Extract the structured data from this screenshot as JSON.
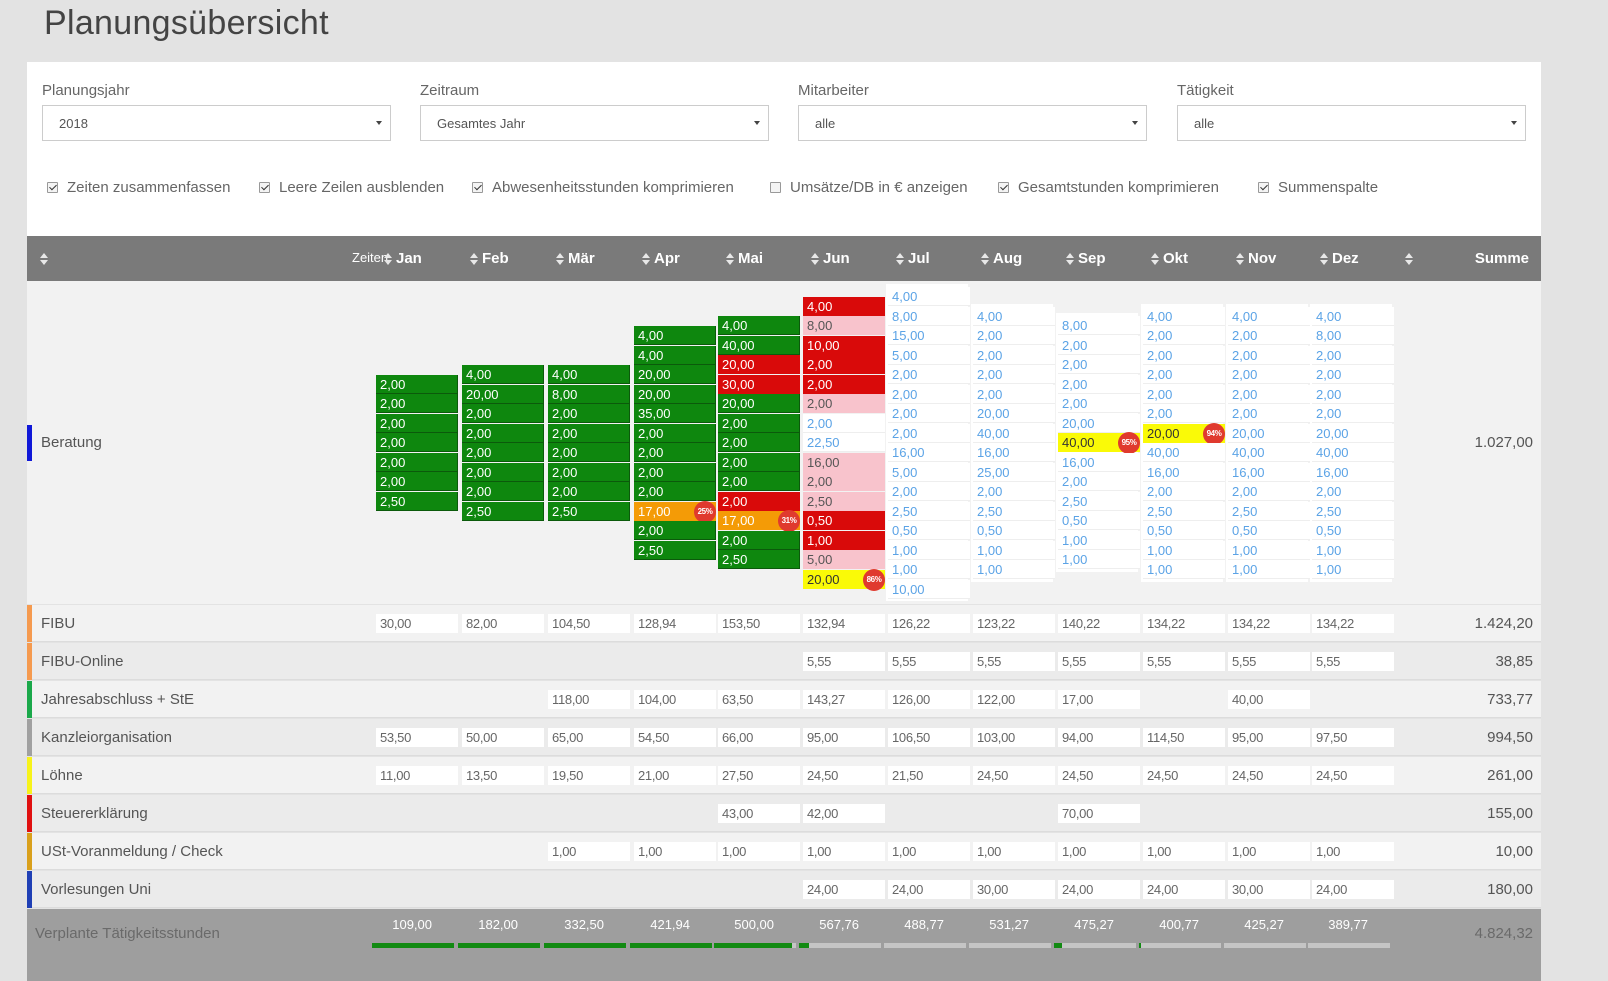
{
  "page": {
    "title": "Planungsübersicht"
  },
  "filters": [
    {
      "label": "Planungsjahr",
      "value": "2018"
    },
    {
      "label": "Zeitraum",
      "value": "Gesamtes Jahr"
    },
    {
      "label": "Mitarbeiter",
      "value": "alle"
    },
    {
      "label": "Tätigkeit",
      "value": "alle"
    }
  ],
  "options": [
    {
      "label": "Zeiten zusammenfassen",
      "checked": true
    },
    {
      "label": "Leere Zeilen ausblenden",
      "checked": true
    },
    {
      "label": "Abwesenheitsstunden komprimieren",
      "checked": true
    },
    {
      "label": "Umsätze/DB in € anzeigen",
      "checked": false
    },
    {
      "label": "Gesamtstunden komprimieren",
      "checked": true
    },
    {
      "label": "Summenspalte",
      "checked": true
    }
  ],
  "table": {
    "zeiten_label": "Zeiten",
    "months": [
      "Jan",
      "Feb",
      "Mär",
      "Apr",
      "Mai",
      "Jun",
      "Jul",
      "Aug",
      "Sep",
      "Okt",
      "Nov",
      "Dez"
    ],
    "sum_label": "Summe",
    "colors": {
      "g": "#0e870e",
      "r": "#d90a0a",
      "p": "#f8c3cc",
      "o": "#f49b06",
      "y": "#fafa07",
      "b": "#5ba3e6"
    },
    "beratung": {
      "label": "Beratung",
      "color": "#1018d8",
      "sum": "1.027,00",
      "months": [
        [
          [
            "2,00",
            "g"
          ],
          [
            "2,00",
            "g"
          ],
          [
            "2,00",
            "g"
          ],
          [
            "2,00",
            "g"
          ],
          [
            "2,00",
            "g"
          ],
          [
            "2,00",
            "g"
          ],
          [
            "2,50",
            "g"
          ]
        ],
        [
          [
            "4,00",
            "g"
          ],
          [
            "20,00",
            "g"
          ],
          [
            "2,00",
            "g"
          ],
          [
            "2,00",
            "g"
          ],
          [
            "2,00",
            "g"
          ],
          [
            "2,00",
            "g"
          ],
          [
            "2,00",
            "g"
          ],
          [
            "2,50",
            "g"
          ]
        ],
        [
          [
            "4,00",
            "g"
          ],
          [
            "8,00",
            "g"
          ],
          [
            "2,00",
            "g"
          ],
          [
            "2,00",
            "g"
          ],
          [
            "2,00",
            "g"
          ],
          [
            "2,00",
            "g"
          ],
          [
            "2,00",
            "g"
          ],
          [
            "2,50",
            "g"
          ]
        ],
        [
          [
            "4,00",
            "g"
          ],
          [
            "4,00",
            "g"
          ],
          [
            "20,00",
            "g"
          ],
          [
            "20,00",
            "g"
          ],
          [
            "35,00",
            "g"
          ],
          [
            "2,00",
            "g"
          ],
          [
            "2,00",
            "g"
          ],
          [
            "2,00",
            "g"
          ],
          [
            "2,00",
            "g"
          ],
          [
            "17,00",
            "o",
            "25%"
          ],
          [
            "2,00",
            "g"
          ],
          [
            "2,50",
            "g"
          ]
        ],
        [
          [
            "4,00",
            "g"
          ],
          [
            "40,00",
            "g"
          ],
          [
            "20,00",
            "r"
          ],
          [
            "30,00",
            "r"
          ],
          [
            "20,00",
            "g"
          ],
          [
            "2,00",
            "g"
          ],
          [
            "2,00",
            "g"
          ],
          [
            "2,00",
            "g"
          ],
          [
            "2,00",
            "g"
          ],
          [
            "2,00",
            "r"
          ],
          [
            "17,00",
            "o",
            "31%"
          ],
          [
            "2,00",
            "g"
          ],
          [
            "2,50",
            "g"
          ]
        ],
        [
          [
            "4,00",
            "r"
          ],
          [
            "8,00",
            "p"
          ],
          [
            "10,00",
            "r"
          ],
          [
            "2,00",
            "r"
          ],
          [
            "2,00",
            "r"
          ],
          [
            "2,00",
            "p"
          ],
          [
            "2,00",
            "b"
          ],
          [
            "22,50",
            "b"
          ],
          [
            "16,00",
            "p"
          ],
          [
            "2,00",
            "p"
          ],
          [
            "2,50",
            "p"
          ],
          [
            "0,50",
            "r"
          ],
          [
            "1,00",
            "r"
          ],
          [
            "5,00",
            "p"
          ],
          [
            "20,00",
            "y",
            "86%"
          ]
        ],
        [
          [
            "4,00",
            "b"
          ],
          [
            "8,00",
            "b"
          ],
          [
            "15,00",
            "b"
          ],
          [
            "5,00",
            "b"
          ],
          [
            "2,00",
            "b"
          ],
          [
            "2,00",
            "b"
          ],
          [
            "2,00",
            "b"
          ],
          [
            "2,00",
            "b"
          ],
          [
            "16,00",
            "b"
          ],
          [
            "5,00",
            "b"
          ],
          [
            "2,00",
            "b"
          ],
          [
            "2,50",
            "b"
          ],
          [
            "0,50",
            "b"
          ],
          [
            "1,00",
            "b"
          ],
          [
            "1,00",
            "b"
          ],
          [
            "10,00",
            "b"
          ]
        ],
        [
          [
            "4,00",
            "b"
          ],
          [
            "2,00",
            "b"
          ],
          [
            "2,00",
            "b"
          ],
          [
            "2,00",
            "b"
          ],
          [
            "2,00",
            "b"
          ],
          [
            "20,00",
            "b"
          ],
          [
            "40,00",
            "b"
          ],
          [
            "16,00",
            "b"
          ],
          [
            "25,00",
            "b"
          ],
          [
            "2,00",
            "b"
          ],
          [
            "2,50",
            "b"
          ],
          [
            "0,50",
            "b"
          ],
          [
            "1,00",
            "b"
          ],
          [
            "1,00",
            "b"
          ]
        ],
        [
          [
            "8,00",
            "b"
          ],
          [
            "2,00",
            "b"
          ],
          [
            "2,00",
            "b"
          ],
          [
            "2,00",
            "b"
          ],
          [
            "2,00",
            "b"
          ],
          [
            "20,00",
            "b"
          ],
          [
            "40,00",
            "y",
            "95%"
          ],
          [
            "16,00",
            "b"
          ],
          [
            "2,00",
            "b"
          ],
          [
            "2,50",
            "b"
          ],
          [
            "0,50",
            "b"
          ],
          [
            "1,00",
            "b"
          ],
          [
            "1,00",
            "b"
          ]
        ],
        [
          [
            "4,00",
            "b"
          ],
          [
            "2,00",
            "b"
          ],
          [
            "2,00",
            "b"
          ],
          [
            "2,00",
            "b"
          ],
          [
            "2,00",
            "b"
          ],
          [
            "2,00",
            "b"
          ],
          [
            "20,00",
            "y",
            "94%"
          ],
          [
            "40,00",
            "b"
          ],
          [
            "16,00",
            "b"
          ],
          [
            "2,00",
            "b"
          ],
          [
            "2,50",
            "b"
          ],
          [
            "0,50",
            "b"
          ],
          [
            "1,00",
            "b"
          ],
          [
            "1,00",
            "b"
          ]
        ],
        [
          [
            "4,00",
            "b"
          ],
          [
            "2,00",
            "b"
          ],
          [
            "2,00",
            "b"
          ],
          [
            "2,00",
            "b"
          ],
          [
            "2,00",
            "b"
          ],
          [
            "2,00",
            "b"
          ],
          [
            "20,00",
            "b"
          ],
          [
            "40,00",
            "b"
          ],
          [
            "16,00",
            "b"
          ],
          [
            "2,00",
            "b"
          ],
          [
            "2,50",
            "b"
          ],
          [
            "0,50",
            "b"
          ],
          [
            "1,00",
            "b"
          ],
          [
            "1,00",
            "b"
          ]
        ],
        [
          [
            "4,00",
            "b"
          ],
          [
            "8,00",
            "b"
          ],
          [
            "2,00",
            "b"
          ],
          [
            "2,00",
            "b"
          ],
          [
            "2,00",
            "b"
          ],
          [
            "2,00",
            "b"
          ],
          [
            "20,00",
            "b"
          ],
          [
            "40,00",
            "b"
          ],
          [
            "16,00",
            "b"
          ],
          [
            "2,00",
            "b"
          ],
          [
            "2,50",
            "b"
          ],
          [
            "0,50",
            "b"
          ],
          [
            "1,00",
            "b"
          ],
          [
            "1,00",
            "b"
          ]
        ]
      ]
    },
    "rows": [
      {
        "label": "FIBU",
        "color": "#f59a4f",
        "sum": "1.424,20",
        "values": [
          "30,00",
          "82,00",
          "104,50",
          "128,94",
          "153,50",
          "132,94",
          "126,22",
          "123,22",
          "140,22",
          "134,22",
          "134,22",
          "134,22"
        ]
      },
      {
        "label": "FIBU-Online",
        "color": "#f59a4f",
        "sum": "38,85",
        "values": [
          "",
          "",
          "",
          "",
          "",
          "5,55",
          "5,55",
          "5,55",
          "5,55",
          "5,55",
          "5,55",
          "5,55"
        ]
      },
      {
        "label": "Jahresabschluss + StE",
        "color": "#1aa84a",
        "sum": "733,77",
        "values": [
          "",
          "",
          "118,00",
          "104,00",
          "63,50",
          "143,27",
          "126,00",
          "122,00",
          "17,00",
          "",
          "40,00",
          ""
        ]
      },
      {
        "label": "Kanzleiorganisation",
        "color": "#a0a0a0",
        "sum": "994,50",
        "values": [
          "53,50",
          "50,00",
          "65,00",
          "54,50",
          "66,00",
          "95,00",
          "106,50",
          "103,00",
          "94,00",
          "114,50",
          "95,00",
          "97,50"
        ]
      },
      {
        "label": "Löhne",
        "color": "#f7f31b",
        "sum": "261,00",
        "values": [
          "11,00",
          "13,50",
          "19,50",
          "21,00",
          "27,50",
          "24,50",
          "21,50",
          "24,50",
          "24,50",
          "24,50",
          "24,50",
          "24,50"
        ]
      },
      {
        "label": "Steuererklärung",
        "color": "#e01010",
        "sum": "155,00",
        "values": [
          "",
          "",
          "",
          "",
          "43,00",
          "42,00",
          "",
          "",
          "70,00",
          "",
          "",
          ""
        ]
      },
      {
        "label": "USt-Voranmeldung / Check",
        "color": "#d9a01c",
        "sum": "10,00",
        "values": [
          "",
          "",
          "1,00",
          "1,00",
          "1,00",
          "1,00",
          "1,00",
          "1,00",
          "1,00",
          "1,00",
          "1,00",
          "1,00"
        ]
      },
      {
        "label": "Vorlesungen Uni",
        "color": "#1f3fb5",
        "sum": "180,00",
        "values": [
          "",
          "",
          "",
          "",
          "",
          "24,00",
          "24,00",
          "30,00",
          "24,00",
          "24,00",
          "30,00",
          "24,00"
        ]
      }
    ],
    "footer": {
      "label": "Verplante Tätigkeitsstunden",
      "sum": "4.824,32",
      "totals": [
        "109,00",
        "182,00",
        "332,50",
        "421,94",
        "500,00",
        "567,76",
        "488,77",
        "531,27",
        "475,27",
        "400,77",
        "425,27",
        "389,77"
      ],
      "progress": [
        1,
        1,
        1,
        1,
        0.95,
        0.12,
        0,
        0,
        0.1,
        0.03,
        0,
        0
      ]
    }
  }
}
